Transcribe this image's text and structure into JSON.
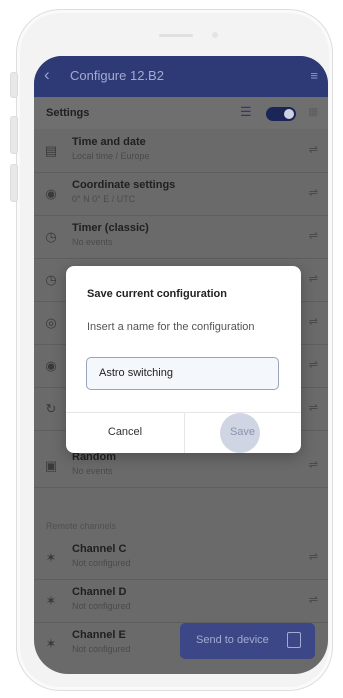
{
  "appbar": {
    "back_icon": "chevron-left-icon",
    "title": "Configure 12.B2",
    "menu_icon": "list-settings-icon"
  },
  "settings": {
    "label": "Settings",
    "list_icon": "list-icon",
    "grid_icon": "grid-icon",
    "toggle_on": true
  },
  "rows": [
    {
      "icon": "calendar-icon",
      "title": "Time and date",
      "subtitle": "Local time / Europe"
    },
    {
      "icon": "location-icon",
      "title": "Coordinate settings",
      "subtitle": "0° N 0° E / UTC"
    },
    {
      "icon": "timer-icon",
      "title": "Timer (classic)",
      "subtitle": "No events"
    },
    {
      "icon": "timer-icon",
      "title": "",
      "subtitle": ""
    },
    {
      "icon": "astro-icon",
      "title": "",
      "subtitle": ""
    },
    {
      "icon": "holiday-icon",
      "title": "",
      "subtitle": ""
    },
    {
      "icon": "cycle-icon",
      "title": "",
      "subtitle": ""
    },
    {
      "icon": "random-icon",
      "title": "Random",
      "subtitle": "No events"
    }
  ],
  "remote": {
    "label": "Remote channels",
    "rows": [
      {
        "icon": "channel-icon",
        "title": "Channel C",
        "subtitle": "Not configured"
      },
      {
        "icon": "channel-icon",
        "title": "Channel D",
        "subtitle": "Not configured"
      },
      {
        "icon": "channel-icon",
        "title": "Channel E",
        "subtitle": "Not configured"
      }
    ]
  },
  "send_button": {
    "label": "Send to device",
    "icon": "device-icon"
  },
  "dialog": {
    "title": "Save current configuration",
    "message": "Insert a name for the configuration",
    "input_value": "Astro switching",
    "cancel_label": "Cancel",
    "save_label": "Save"
  }
}
